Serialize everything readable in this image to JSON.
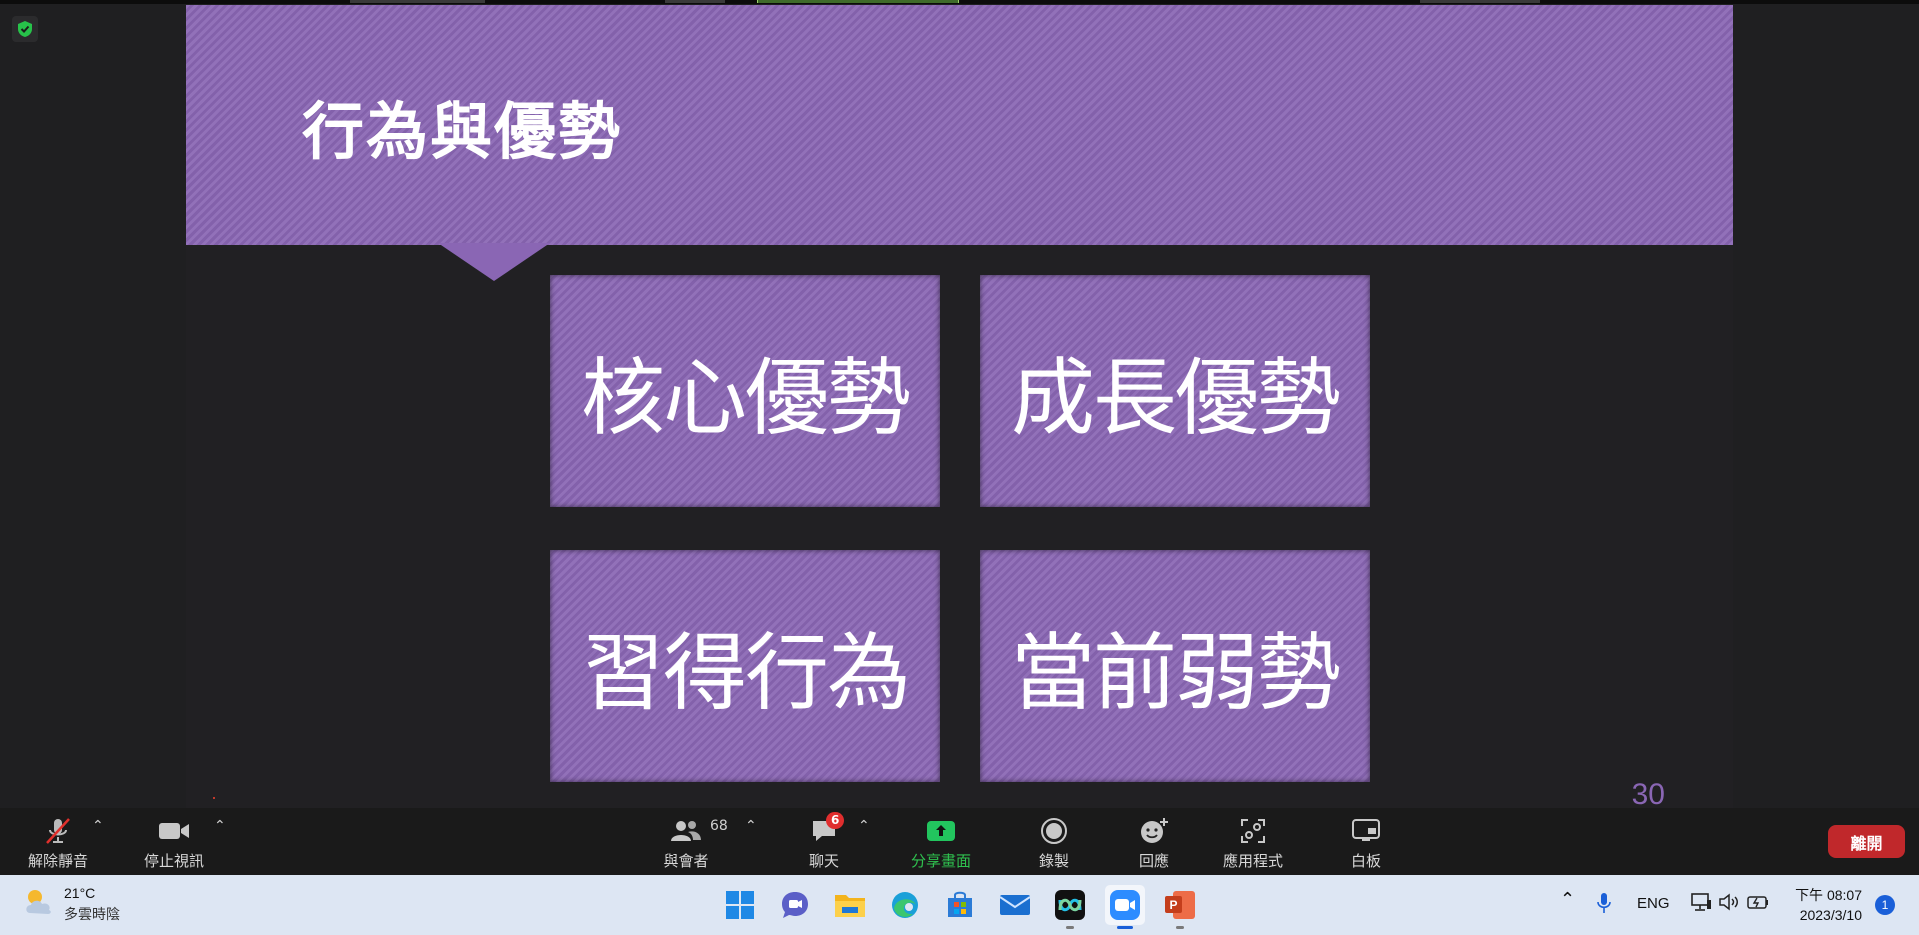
{
  "slide": {
    "title": "行為與優勢",
    "boxes": [
      "核心優勢",
      "成長優勢",
      "習得行為",
      "當前弱勢"
    ],
    "page_number": "30",
    "accent_color": "#8a66b4"
  },
  "toolbar": {
    "mute_label": "解除靜音",
    "video_label": "停止視訊",
    "participants_label": "與會者",
    "participants_count": "68",
    "chat_label": "聊天",
    "chat_badge": "6",
    "share_label": "分享畫面",
    "record_label": "錄製",
    "reactions_label": "回應",
    "apps_label": "應用程式",
    "whiteboard_label": "白板",
    "leave_label": "離開"
  },
  "taskbar": {
    "weather_temp": "21°C",
    "weather_desc": "多雲時陰",
    "language": "ENG",
    "time": "下午 08:07",
    "date": "2023/3/10",
    "notification_count": "1",
    "apps": [
      "start-icon",
      "teams-chat-icon",
      "file-explorer-icon",
      "edge-icon",
      "microsoft-store-icon",
      "mail-icon",
      "webex-icon",
      "zoom-icon",
      "powerpoint-icon"
    ]
  }
}
